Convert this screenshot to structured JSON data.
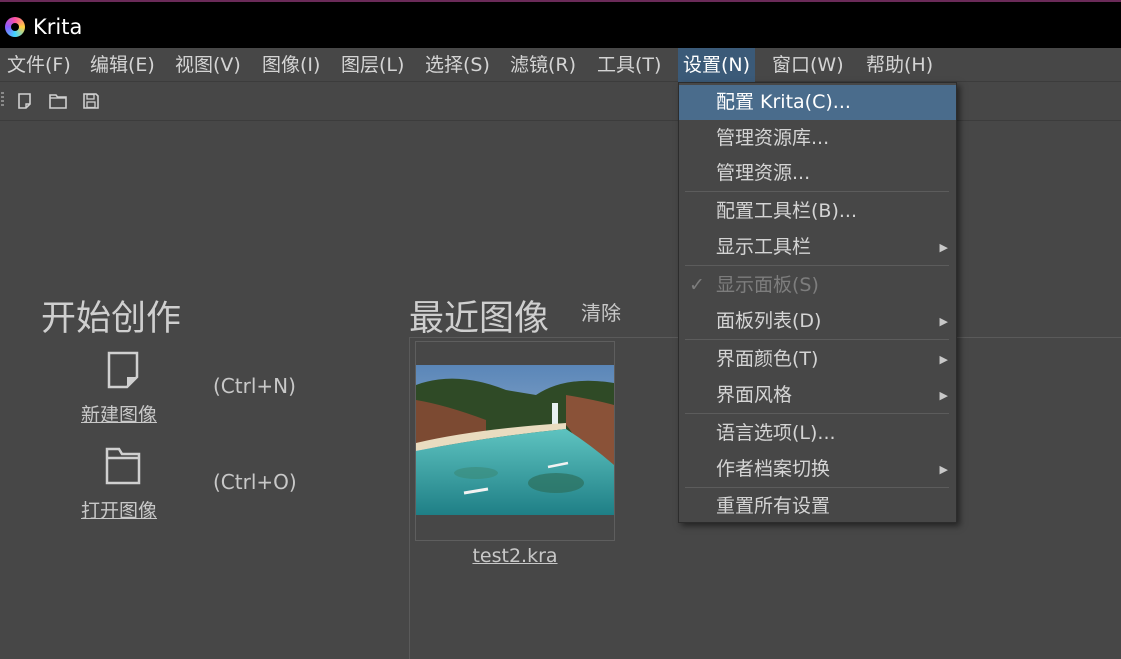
{
  "window": {
    "title": "Krita"
  },
  "menubar": [
    "文件(F)",
    "编辑(E)",
    "视图(V)",
    "图像(I)",
    "图层(L)",
    "选择(S)",
    "滤镜(R)",
    "工具(T)",
    "设置(N)",
    "窗口(W)",
    "帮助(H)"
  ],
  "toolbar": {
    "icons": [
      "new-document-icon",
      "open-folder-icon",
      "save-icon"
    ]
  },
  "start": {
    "title": "开始创作",
    "new_label": "新建图像",
    "new_shortcut": "(Ctrl+N)",
    "open_label": "打开图像",
    "open_shortcut": "(Ctrl+O)"
  },
  "recent": {
    "title": "最近图像",
    "clear_label": "清除",
    "items": [
      {
        "name": "test2.kra"
      }
    ]
  },
  "settings_menu": {
    "items": [
      {
        "label": "配置 Krita(C)...",
        "highlighted": true
      },
      {
        "label": "管理资源库..."
      },
      {
        "label": "管理资源..."
      },
      {
        "label": "配置工具栏(B)..."
      },
      {
        "label": "显示工具栏",
        "submenu": true
      },
      {
        "label": "显示面板(S)",
        "checked": true,
        "disabled": true
      },
      {
        "label": "面板列表(D)",
        "submenu": true
      },
      {
        "label": "界面颜色(T)",
        "submenu": true
      },
      {
        "label": "界面风格",
        "submenu": true
      },
      {
        "label": "语言选项(L)..."
      },
      {
        "label": "作者档案切换",
        "submenu": true
      },
      {
        "label": "重置所有设置"
      }
    ],
    "submenu_arrow": "▶",
    "check_mark": "✓"
  },
  "colors": {
    "background": "#474747",
    "highlight": "#4a6c8c",
    "active_menu": "#3b5a78"
  }
}
